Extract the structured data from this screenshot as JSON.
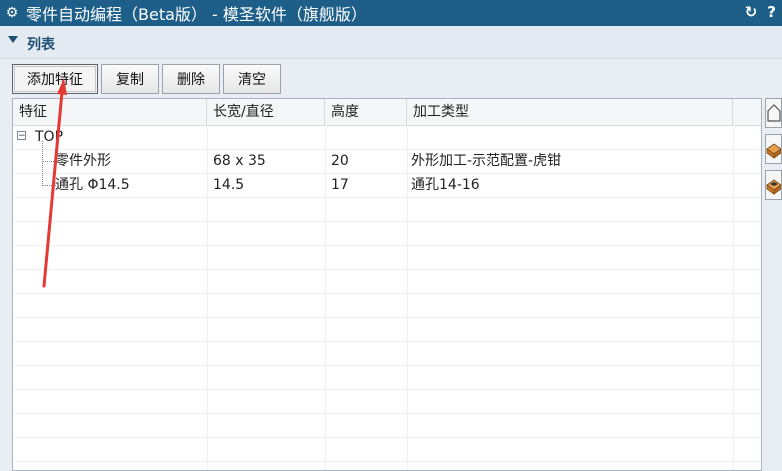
{
  "window": {
    "title": "零件自动编程（Beta版） - 模圣软件（旗舰版）",
    "refresh_icon": "refresh-icon",
    "help_label": "?"
  },
  "section": {
    "label": "列表"
  },
  "toolbar": {
    "buttons": [
      {
        "label": "添加特征"
      },
      {
        "label": "复制"
      },
      {
        "label": "删除"
      },
      {
        "label": "清空"
      }
    ]
  },
  "table": {
    "columns": [
      "特征",
      "长宽/直径",
      "高度",
      "加工类型"
    ],
    "root": {
      "label": "TOP",
      "expander": "⊟"
    },
    "rows": [
      {
        "feature": "零件外形",
        "size": "68 x 35",
        "height": "20",
        "type": "外形加工-示范配置-虎钳"
      },
      {
        "feature": "通孔 Φ14.5",
        "size": "14.5",
        "height": "17",
        "type": "通孔14-16"
      }
    ]
  },
  "side_icons": [
    "home-view-icon",
    "top-view-icon",
    "part-view-icon"
  ],
  "colors": {
    "titlebar": "#1e5f8a",
    "accent_arrow": "#e53935"
  }
}
